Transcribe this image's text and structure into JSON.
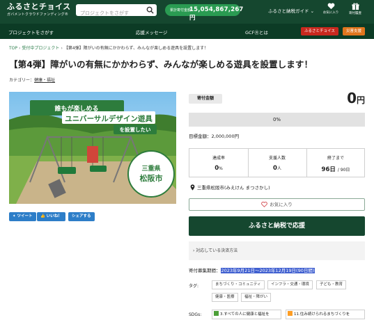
{
  "header": {
    "logo_line1": "ふるさとチョイス",
    "logo_line2": "ガバメントクラウドファンディング®",
    "search_placeholder": "プロジェクトをさがす",
    "total_label": "累計寄付金額",
    "total_amount": "15,054,867,267",
    "total_unit": "円",
    "guide": "ふるさと納税ガイド",
    "icons": [
      {
        "name": "heart-icon",
        "label": "お気に入り"
      },
      {
        "name": "gift-icon",
        "label": "寄付履歴"
      }
    ]
  },
  "nav": {
    "items": [
      "プロジェクトをさがす",
      "応援メッセージ",
      "GCFⓇとは"
    ],
    "badges": [
      {
        "label": "ふるさとチョイス",
        "color": "#c8281e"
      },
      {
        "label": "災害支援",
        "color": "#e0751d"
      }
    ]
  },
  "breadcrumb": {
    "items": [
      "TOP",
      "受付中プロジェクト"
    ],
    "current": "【第4弾】障がいの有無にかかわらず、みんなが楽しめる遊具を設置します！"
  },
  "project": {
    "title": "【第4弾】障がいの有無にかかわらず、みんなが楽しめる遊具を設置します！",
    "category_label": "カテゴリー：",
    "category": "健康・福祉",
    "image": {
      "caption_top": "誰もが楽しめる",
      "caption_main": "ユニバーサルデザイン遊具",
      "caption_sub": "を設置したい",
      "pref": "三重県",
      "city": "松阪市"
    }
  },
  "share": {
    "tweet": "ツイート",
    "like": "いいね！",
    "share": "シェアする"
  },
  "funding": {
    "label": "寄付金額",
    "amount": "0",
    "unit": "円",
    "progress_text": "0%",
    "progress": 0,
    "goal": "目標金額：2,000,000円",
    "stats": [
      {
        "label": "達成率",
        "value": "0",
        "unit": "%"
      },
      {
        "label": "支援人数",
        "value": "0",
        "unit": "人"
      },
      {
        "label": "終了まで",
        "value": "96日",
        "unit": "/ 90日"
      }
    ],
    "location": "三重県松阪市(みえけん まつさかし)",
    "fav_label": "お気に入り",
    "cta_label": "ふるさと納税で応援",
    "pay_label": "› 対応している決済方法",
    "period_label": "寄付募集期間：",
    "period_value": "2023年9月21日～2023年12月19日(90日間)",
    "tags_label": "タグ:",
    "tags": [
      "まちづくり・コミュニティ",
      "インフラ・交通・環境",
      "子ども・教育",
      "健康・医療",
      "福祉・障がい"
    ],
    "sdgs_label": "SDGs:",
    "sdgs": [
      {
        "text": "3.すべての人に健康と福祉を",
        "color": "#4c9f38"
      },
      {
        "text": "11.住み続けられるまちづくりを",
        "color": "#fd9d24"
      }
    ]
  }
}
